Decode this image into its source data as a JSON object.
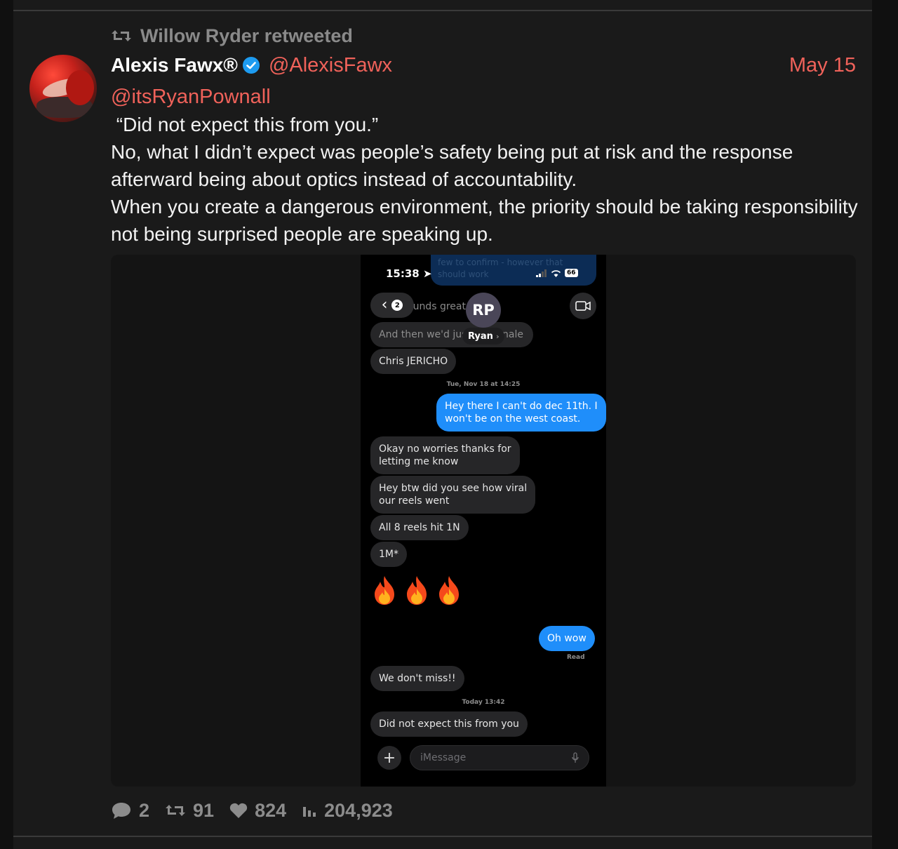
{
  "retweet": {
    "text": "Willow Ryder retweeted"
  },
  "tweet": {
    "author_name": "Alexis Fawx®",
    "author_handle": "@AlexisFawx",
    "date": "May 15",
    "reply_mention": "@itsRyanPownall",
    "body_lines": [
      " “Did not expect this from you.”",
      "No, what I didn’t expect was people’s safety being put at risk and the response afterward being about optics instead of accountability.",
      "When you create a dangerous environment, the priority should be taking responsibility not being surprised people are speaking up."
    ]
  },
  "screenshot": {
    "status_time": "15:38",
    "battery": "66",
    "back_count": "2",
    "contact_initials": "RP",
    "contact_name": "Ryan",
    "ghost_top": "few to confirm - however that should work",
    "faded_1": "ounds great",
    "faded_2": "And then we'd jus",
    "faded_2_tail": "nale",
    "messages": {
      "m1": "Chris JERICHO",
      "stamp1": "Tue, Nov 18 at 14:25",
      "m2": "Hey there I can't do dec 11th. I\nwon't be on the west coast.",
      "m3": "Okay no worries thanks for\nletting me know",
      "m4": "Hey btw did you see how viral\nour reels went",
      "m5": "All 8 reels hit 1N",
      "m6": "1M*",
      "m7": "Oh wow",
      "read": "Read",
      "m8": "We don't miss!!",
      "stamp2": "Today 13:42",
      "m9": "Did not expect this from you"
    },
    "input_placeholder": "iMessage"
  },
  "stats": {
    "replies": "2",
    "retweets": "91",
    "likes": "824",
    "views": "204,923"
  },
  "colors": {
    "accent": "#f0625a",
    "verified": "#1d9bf0",
    "imessage_blue": "#1f8efa"
  }
}
